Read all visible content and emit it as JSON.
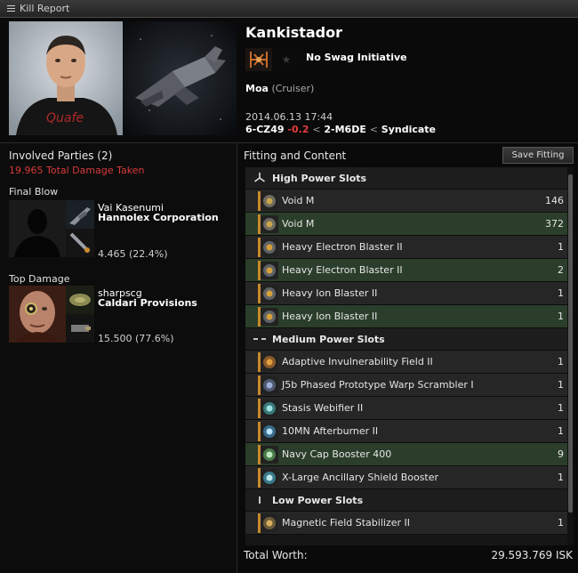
{
  "window": {
    "title": "Kill Report"
  },
  "victim": {
    "name": "Kankistador",
    "corporation": "No Swag Initiative",
    "ship": "Moa",
    "ship_class": "(Cruiser)",
    "datetime": "2014.06.13 17:44",
    "system": "6-CZ49",
    "security": "-0.2",
    "constellation": "2-M6DE",
    "region": "Syndicate",
    "arrow": "<"
  },
  "involved": {
    "title": "Involved Parties (2)",
    "damage_taken": "19.965 Total Damage Taken",
    "final_blow_label": "Final Blow",
    "top_damage_label": "Top Damage",
    "final_blow": {
      "name": "Vai Kasenumi",
      "corp": "Hannolex Corporation",
      "damage": "4.465 (22.4%)"
    },
    "top_damage": {
      "name": "sharpscg",
      "corp": "Caldari Provisions",
      "damage": "15.500 (77.6%)"
    }
  },
  "fitting": {
    "title": "Fitting and Content",
    "save_label": "Save Fitting",
    "groups": [
      {
        "name": "High Power Slots",
        "icon": "high-slot-icon",
        "items": [
          {
            "name": "Void M",
            "qty": "146",
            "state": "dest",
            "icon": "ammo-icon"
          },
          {
            "name": "Void M",
            "qty": "372",
            "state": "drop",
            "icon": "ammo-icon"
          },
          {
            "name": "Heavy Electron Blaster II",
            "qty": "1",
            "state": "dest",
            "icon": "blaster-icon"
          },
          {
            "name": "Heavy Electron Blaster II",
            "qty": "2",
            "state": "drop",
            "icon": "blaster-icon"
          },
          {
            "name": "Heavy Ion Blaster II",
            "qty": "1",
            "state": "dest",
            "icon": "blaster-icon"
          },
          {
            "name": "Heavy Ion Blaster II",
            "qty": "1",
            "state": "drop",
            "icon": "blaster-icon"
          }
        ]
      },
      {
        "name": "Medium Power Slots",
        "icon": "mid-slot-icon",
        "items": [
          {
            "name": "Adaptive Invulnerability Field II",
            "qty": "1",
            "state": "dest",
            "icon": "shield-hardener-icon"
          },
          {
            "name": "J5b Phased Prototype Warp Scrambler I",
            "qty": "1",
            "state": "dest",
            "icon": "warp-scrambler-icon"
          },
          {
            "name": "Stasis Webifier II",
            "qty": "1",
            "state": "dest",
            "icon": "webifier-icon"
          },
          {
            "name": "10MN Afterburner II",
            "qty": "1",
            "state": "dest",
            "icon": "afterburner-icon"
          },
          {
            "name": "Navy Cap Booster 400",
            "qty": "9",
            "state": "drop",
            "icon": "cap-booster-icon"
          },
          {
            "name": "X-Large Ancillary Shield Booster",
            "qty": "1",
            "state": "dest",
            "icon": "shield-booster-icon"
          }
        ]
      },
      {
        "name": "Low Power Slots",
        "icon": "low-slot-icon",
        "items": [
          {
            "name": "Magnetic Field Stabilizer II",
            "qty": "1",
            "state": "dest",
            "icon": "damage-mod-icon"
          }
        ]
      }
    ]
  },
  "total": {
    "label": "Total Worth:",
    "value": "29.593.769 ISK"
  },
  "colors": {
    "dropped": "#2b3e2b",
    "destroyed": "#262626",
    "security": "#e53b3b",
    "damage": "#d83a3a"
  }
}
